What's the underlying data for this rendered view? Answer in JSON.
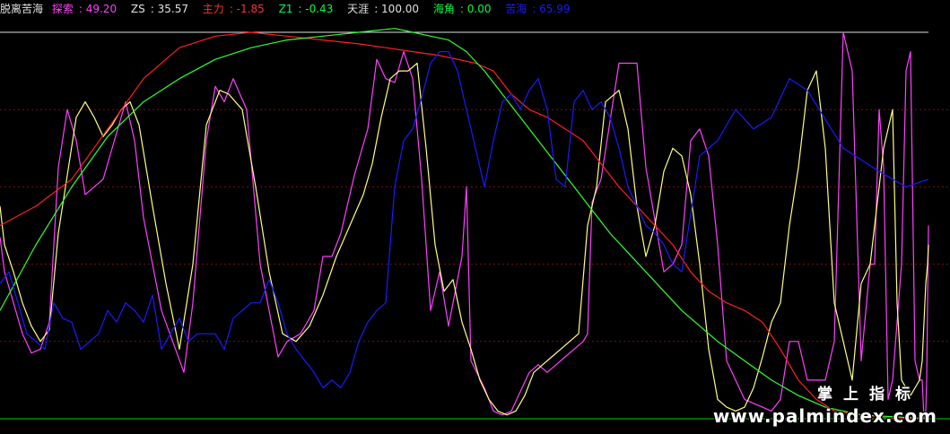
{
  "header": {
    "name": "脱离苦海",
    "items": [
      {
        "label": "探索",
        "value": "49.20",
        "color": "#ff40ff"
      },
      {
        "label": "ZS",
        "value": "35.57",
        "color": "#e0e0e0"
      },
      {
        "label": "主力",
        "value": "-1.85",
        "color": "#ff3030"
      },
      {
        "label": "Z1",
        "value": "-0.43",
        "color": "#00ff40"
      },
      {
        "label": "天涯",
        "value": "100.00",
        "color": "#e0e0e0"
      },
      {
        "label": "海角",
        "value": "0.00",
        "color": "#00ff40"
      },
      {
        "label": "苦海",
        "value": "65.99",
        "color": "#1a1aff"
      }
    ]
  },
  "watermark": {
    "cn": "掌上指标",
    "url": "www.palmindex.com"
  },
  "chart_data": {
    "type": "line",
    "ylim": [
      0,
      100
    ],
    "grid": true,
    "reference_lines": [
      {
        "name": "天涯",
        "value": 100,
        "color": "#e0e0e0",
        "style": "solid"
      },
      {
        "name": "海角",
        "value": 0,
        "color": "#00cc00",
        "style": "solid"
      }
    ],
    "grid_levels": [
      80,
      60,
      40,
      20
    ],
    "series": [
      {
        "name": "探索",
        "color": "#ff40ff",
        "values": [
          47,
          38,
          30,
          22,
          17,
          18,
          25,
          65,
          80,
          72,
          58,
          60,
          62,
          82,
          72,
          52,
          28,
          12,
          30,
          72,
          86,
          82,
          88,
          80,
          40,
          28,
          16,
          20,
          22,
          28,
          42,
          42,
          48,
          63,
          75,
          93,
          88,
          87,
          95,
          88,
          62,
          28,
          38,
          24,
          42,
          60,
          15,
          8,
          2,
          1,
          2,
          7,
          12,
          14,
          12,
          14,
          16,
          18,
          20,
          22,
          56,
          62,
          92,
          92,
          65,
          38,
          40,
          45,
          72,
          75,
          68,
          45,
          15,
          5,
          4,
          3,
          2,
          5,
          20,
          20,
          10,
          10,
          10,
          20,
          100,
          90,
          15,
          40,
          40,
          80,
          65,
          5,
          10,
          25,
          40,
          90,
          95,
          15,
          10,
          10,
          0,
          0,
          2,
          10,
          30,
          50
        ],
        "x": [
          0,
          5,
          15,
          25,
          35,
          45,
          55,
          65,
          75,
          85,
          95,
          105,
          115,
          140,
          150,
          160,
          180,
          205,
          215,
          230,
          240,
          250,
          260,
          275,
          290,
          300,
          310,
          320,
          335,
          350,
          360,
          370,
          380,
          395,
          410,
          420,
          430,
          440,
          450,
          460,
          470,
          480,
          490,
          500,
          515,
          520,
          525,
          540,
          550,
          560,
          570,
          580,
          590,
          600,
          610,
          620,
          630,
          640,
          650,
          655,
          660,
          670,
          690,
          710,
          720,
          740,
          750,
          760,
          770,
          780,
          790,
          800,
          810,
          830,
          840,
          850,
          860,
          870,
          880,
          890,
          900,
          910,
          920,
          930,
          940,
          950,
          960,
          970,
          975,
          980,
          985,
          990,
          995,
          1000,
          1005,
          1010,
          1015,
          1020,
          1025,
          1028,
          1030,
          1031,
          1032,
          1033,
          1034,
          1035
        ]
      },
      {
        "name": "ZS",
        "color": "#ffff80",
        "values": [
          55,
          45,
          38,
          30,
          24,
          20,
          23,
          48,
          78,
          82,
          78,
          73,
          76,
          80,
          82,
          76,
          55,
          35,
          18,
          40,
          76,
          85,
          84,
          80,
          60,
          38,
          22,
          20,
          24,
          32,
          42,
          50,
          58,
          66,
          78,
          88,
          90,
          90,
          92,
          70,
          45,
          33,
          36,
          25,
          18,
          10,
          5,
          2,
          1,
          2,
          6,
          12,
          14,
          16,
          18,
          20,
          22,
          50,
          60,
          82,
          85,
          75,
          55,
          42,
          50,
          64,
          70,
          68,
          58,
          40,
          18,
          5,
          3,
          2,
          3,
          8,
          16,
          25,
          30,
          50,
          65,
          85,
          90,
          70,
          30,
          20,
          10,
          35,
          40,
          60,
          70,
          75,
          80,
          30,
          10,
          8,
          6,
          8,
          10,
          15,
          25,
          35,
          40,
          45
        ],
        "x": [
          0,
          5,
          15,
          25,
          35,
          45,
          55,
          65,
          85,
          95,
          105,
          115,
          125,
          135,
          145,
          155,
          170,
          185,
          200,
          215,
          230,
          245,
          255,
          270,
          285,
          300,
          315,
          330,
          345,
          360,
          375,
          390,
          405,
          415,
          425,
          435,
          445,
          455,
          465,
          475,
          485,
          495,
          505,
          515,
          525,
          535,
          545,
          555,
          565,
          575,
          585,
          595,
          605,
          615,
          625,
          635,
          645,
          655,
          665,
          675,
          690,
          700,
          710,
          720,
          730,
          740,
          750,
          760,
          770,
          780,
          790,
          800,
          810,
          820,
          830,
          840,
          850,
          860,
          870,
          880,
          890,
          900,
          910,
          920,
          930,
          940,
          950,
          960,
          970,
          980,
          985,
          990,
          995,
          1000,
          1005,
          1010,
          1015,
          1020,
          1025,
          1028,
          1030,
          1032,
          1034,
          1035
        ]
      },
      {
        "name": "主力",
        "color": "#ff2020",
        "values": [
          50,
          55,
          62,
          75,
          88,
          96,
          99,
          100,
          99,
          98,
          97,
          96,
          95,
          94,
          93,
          92,
          90,
          84,
          80,
          78,
          75,
          72,
          66,
          60,
          55,
          50,
          45,
          38,
          33,
          30,
          28,
          25,
          18,
          10,
          5,
          2,
          1,
          0,
          0
        ],
        "x": [
          0,
          40,
          80,
          120,
          160,
          200,
          240,
          280,
          320,
          360,
          400,
          430,
          460,
          490,
          510,
          530,
          550,
          570,
          590,
          610,
          630,
          650,
          670,
          690,
          710,
          730,
          750,
          770,
          790,
          810,
          830,
          850,
          870,
          890,
          910,
          930,
          960,
          1000,
          1035
        ]
      },
      {
        "name": "Z1",
        "color": "#30ff30",
        "values": [
          28,
          45,
          60,
          73,
          82,
          88,
          93,
          96,
          98,
          99,
          100,
          101,
          100,
          99,
          98,
          95,
          90,
          84,
          78,
          72,
          66,
          60,
          54,
          48,
          43,
          38,
          33,
          28,
          24,
          20,
          15,
          10,
          6,
          3,
          1,
          0
        ],
        "x": [
          0,
          40,
          80,
          120,
          160,
          200,
          240,
          280,
          320,
          360,
          400,
          440,
          460,
          480,
          500,
          520,
          540,
          560,
          580,
          600,
          620,
          640,
          660,
          680,
          700,
          720,
          740,
          760,
          780,
          800,
          830,
          860,
          890,
          920,
          960,
          1035
        ]
      },
      {
        "name": "苦海",
        "color": "#1a1aff",
        "values": [
          35,
          38,
          30,
          22,
          20,
          18,
          30,
          26,
          25,
          18,
          20,
          22,
          28,
          25,
          30,
          28,
          25,
          32,
          18,
          22,
          26,
          20,
          22,
          22,
          22,
          18,
          26,
          28,
          30,
          30,
          36,
          30,
          22,
          18,
          15,
          12,
          8,
          10,
          8,
          12,
          20,
          25,
          28,
          30,
          60,
          72,
          75,
          83,
          92,
          95,
          95,
          90,
          80,
          70,
          60,
          72,
          82,
          84,
          80,
          85,
          88,
          80,
          62,
          60,
          82,
          85,
          80,
          82,
          78,
          70,
          60,
          55,
          50,
          48,
          45,
          40,
          38,
          68,
          72,
          80,
          75,
          78,
          88,
          85,
          70,
          64,
          60,
          62
        ],
        "x": [
          0,
          10,
          20,
          30,
          40,
          50,
          60,
          70,
          80,
          90,
          100,
          110,
          120,
          130,
          140,
          150,
          160,
          170,
          180,
          190,
          200,
          210,
          220,
          230,
          240,
          250,
          260,
          270,
          280,
          290,
          300,
          310,
          320,
          330,
          340,
          350,
          360,
          370,
          380,
          390,
          400,
          410,
          420,
          430,
          440,
          450,
          460,
          470,
          480,
          490,
          500,
          510,
          520,
          530,
          540,
          550,
          560,
          570,
          580,
          590,
          600,
          610,
          620,
          630,
          640,
          650,
          660,
          670,
          680,
          690,
          700,
          710,
          720,
          730,
          740,
          750,
          760,
          780,
          800,
          820,
          840,
          860,
          880,
          900,
          940,
          980,
          1010,
          1035
        ]
      }
    ]
  }
}
